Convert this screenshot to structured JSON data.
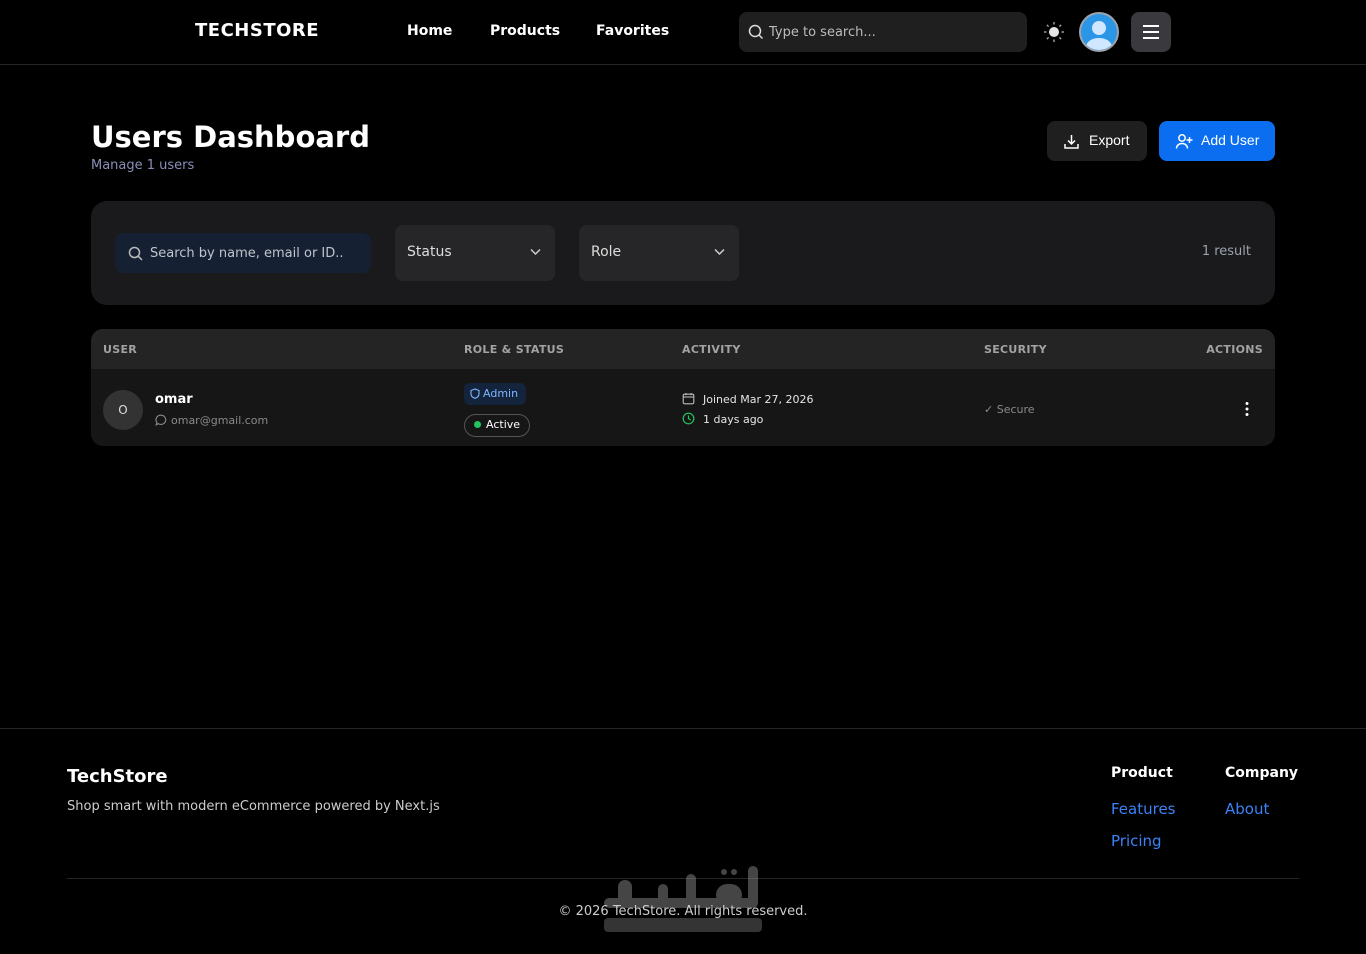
{
  "header": {
    "logo": "TECHSTORE",
    "nav": [
      "Home",
      "Products",
      "Favorites"
    ],
    "search_placeholder": "Type to search..."
  },
  "page": {
    "title": "Users Dashboard",
    "subtitle": "Manage 1 users",
    "export_label": "Export",
    "add_user_label": "Add User"
  },
  "filters": {
    "search_placeholder": "Search by name, email or ID..",
    "status_label": "Status",
    "role_label": "Role",
    "result_count": "1 result"
  },
  "table": {
    "columns": [
      "USER",
      "ROLE & STATUS",
      "ACTIVITY",
      "SECURITY",
      "ACTIONS"
    ],
    "rows": [
      {
        "initial": "O",
        "name": "omar",
        "email": "omar@gmail.com",
        "role": "Admin",
        "status": "Active",
        "joined": "Joined Mar 27, 2026",
        "last_active": "1 days ago",
        "security": "✓ Secure"
      }
    ]
  },
  "footer": {
    "brand": "TechStore",
    "tagline": "Shop smart with modern eCommerce powered by Next.js",
    "product_heading": "Product",
    "product_links": [
      "Features",
      "Pricing"
    ],
    "company_heading": "Company",
    "company_links": [
      "About"
    ],
    "copyright": "© 2026 TechStore. All rights reserved."
  },
  "colors": {
    "accent": "#0b6ef0",
    "link": "#3b82f6",
    "active_dot": "#22c55e",
    "background": "#000000"
  },
  "icons": [
    "search-icon",
    "sun-icon",
    "user-avatar-icon",
    "menu-icon",
    "download-icon",
    "user-plus-icon",
    "chevron-down-icon",
    "message-icon",
    "shield-icon",
    "calendar-icon",
    "clock-icon",
    "more-vertical-icon"
  ]
}
